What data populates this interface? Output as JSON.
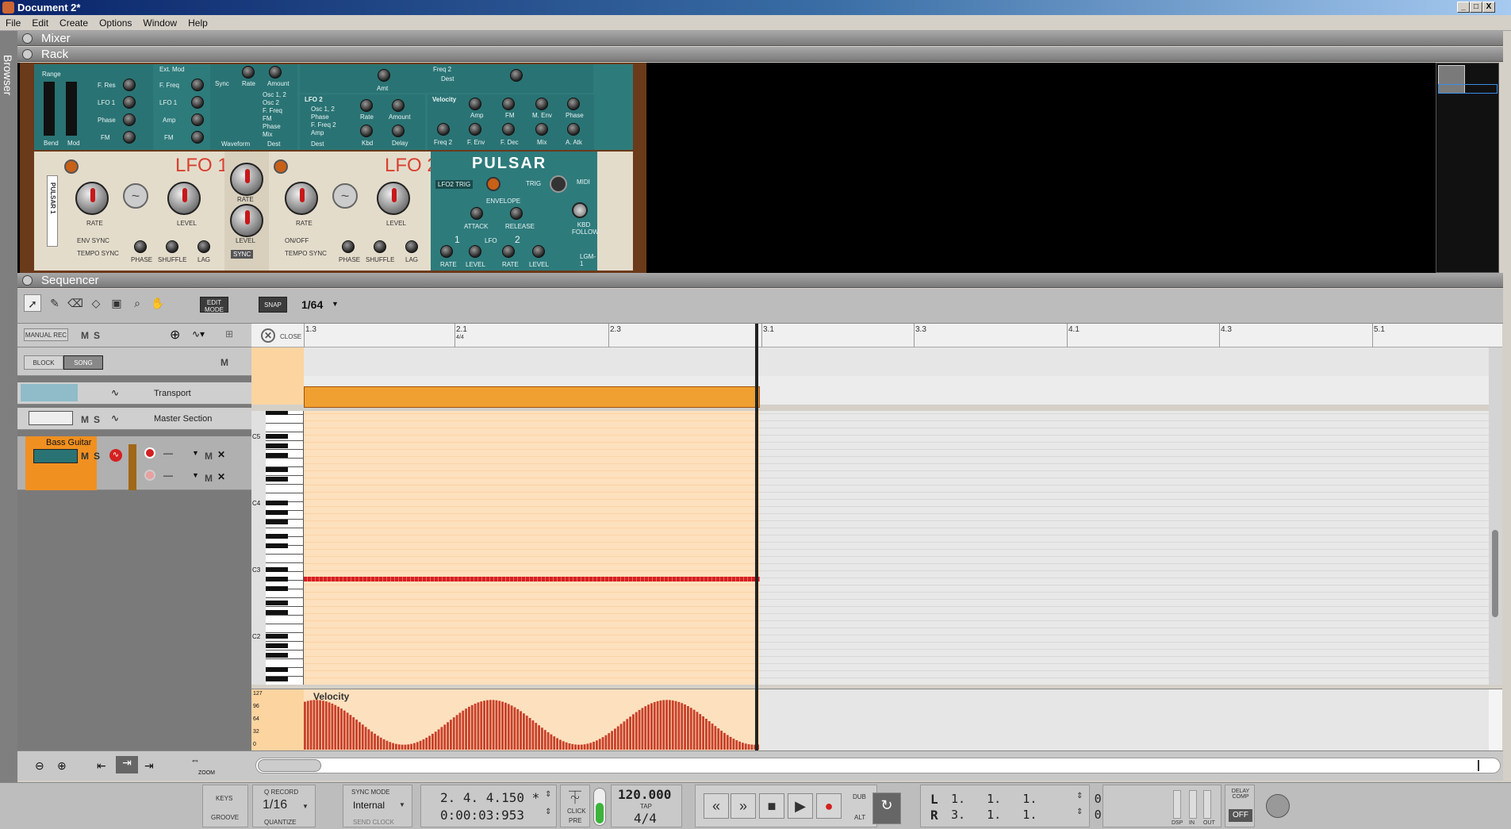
{
  "window": {
    "title": "Document 2*",
    "minimize": "_",
    "maximize": "□",
    "close": "X"
  },
  "menu": [
    "File",
    "Edit",
    "Create",
    "Options",
    "Window",
    "Help"
  ],
  "browser_label": "Browser",
  "sections": {
    "mixer": "Mixer",
    "rack": "Rack",
    "sequencer": "Sequencer"
  },
  "rack": {
    "upper_labels": {
      "range": "Range",
      "bend": "Bend",
      "mod": "Mod",
      "f_freq": "F. Freq",
      "f_res": "F. Res",
      "lfo1": "LFO 1",
      "phase": "Phase",
      "fm": "FM",
      "ext_mod": "Ext. Mod",
      "f_freq2": "F. Freq",
      "lfo1b": "LFO 1",
      "amp": "Amp",
      "fm2": "FM",
      "sync": "Sync",
      "rate": "Rate",
      "amount": "Amount",
      "waveform": "Waveform",
      "dest": "Dest",
      "osc12": "Osc 1, 2",
      "osc2": "Osc 2",
      "f_freq3": "F. Freq",
      "fm3": "FM",
      "phase2": "Phase",
      "mix": "Mix",
      "lfo2": "LFO 2",
      "lfo2_osc12": "Osc 1, 2",
      "lfo2_phase": "Phase",
      "lfo2_ffreq2": "F. Freq 2",
      "lfo2_amp": "Amp",
      "lfo2_dest": "Dest",
      "lfo2_rate": "Rate",
      "lfo2_amount": "Amount",
      "lfo2_kbd": "Kbd",
      "lfo2_delay": "Delay",
      "freq2": "Freq 2",
      "dest2": "Dest",
      "amt": "Amt",
      "velocity": "Velocity",
      "v_amp": "Amp",
      "v_fm": "FM",
      "v_menv": "M. Env",
      "v_phase": "Phase",
      "v_freq2": "Freq 2",
      "v_fenv": "F. Env",
      "v_fdec": "F. Dec",
      "v_mix": "Mix",
      "v_aatk": "A. Atk"
    },
    "lfo1": {
      "title": "LFO",
      "num": "1",
      "rate": "RATE",
      "level": "LEVEL",
      "env_sync": "ENV SYNC",
      "tempo_sync": "TEMPO SYNC",
      "phase": "PHASE",
      "shuffle": "SHUFFLE",
      "lag": "LAG"
    },
    "mid": {
      "rate": "RATE",
      "level": "LEVEL",
      "sync": "SYNC"
    },
    "lfo2": {
      "title": "LFO",
      "num": "2",
      "rate": "RATE",
      "level": "LEVEL",
      "onoff": "ON/OFF",
      "tempo_sync": "TEMPO SYNC",
      "phase": "PHASE",
      "shuffle": "SHUFFLE",
      "lag": "LAG"
    },
    "pulsar": {
      "logo": "PULSAR",
      "lfo2_trig": "LFO2 TRIG",
      "trig": "TRIG",
      "midi": "MIDI",
      "envelope": "ENVELOPE",
      "attack": "ATTACK",
      "release": "RELEASE",
      "kbd_follow": "KBD FOLLOW",
      "lfo": "LFO",
      "rate1": "RATE",
      "level1": "LEVEL",
      "rate2": "RATE",
      "level2": "LEVEL",
      "one": "1",
      "two": "2",
      "lgm": "LGM-1"
    },
    "device_name": "PULSAR 1"
  },
  "sequencer": {
    "edit_mode": "EDIT MODE",
    "snap": "SNAP",
    "snap_value": "1/64",
    "manual_rec": "MANUAL REC",
    "m": "M",
    "s": "S",
    "block": "BLOCK",
    "song": "SONG",
    "close": "CLOSE",
    "tracks": [
      {
        "name": "Transport"
      },
      {
        "name": "Master Section"
      },
      {
        "name": "Bass Guitar"
      }
    ],
    "ruler": [
      "1.3",
      "2.1",
      "2.3",
      "3.1",
      "3.3",
      "4.1",
      "4.3",
      "5.1"
    ],
    "ruler_sub": "4/4",
    "notes": [
      "C5",
      "C4",
      "C3",
      "C2"
    ],
    "velocity_label": "Velocity",
    "velocity_ticks": [
      "127",
      "96",
      "64",
      "32",
      "0"
    ],
    "zoom_label": "ZOOM"
  },
  "transport": {
    "keys": "KEYS",
    "groove": "GROOVE",
    "q_record": "Q RECORD",
    "quantize_value": "1/16",
    "quantize": "QUANTIZE",
    "sync_mode": "SYNC MODE",
    "sync_value": "Internal",
    "send_clock": "SEND CLOCK",
    "position": "2. 4. 4.150 *",
    "time": "0:00:03:953",
    "click": "CLICK",
    "pre": "PRE",
    "tempo": "120.000",
    "tap": "TAP",
    "signature": "4/4",
    "dub": "DUB",
    "alt": "ALT",
    "loop_l": "L",
    "loop_r": "R",
    "loop_l_val": "1.   1.   1.        0",
    "loop_r_val": "3.   1.   1.        0",
    "delay_comp": "DELAY COMP",
    "delay_off": "OFF",
    "dsp": "DSP",
    "in": "IN",
    "out": "OUT"
  }
}
